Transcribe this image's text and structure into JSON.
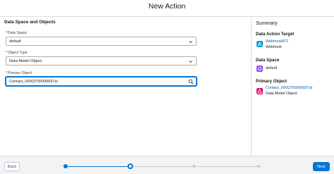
{
  "header": {
    "title": "New Action"
  },
  "form": {
    "section_title": "Data Space and Objects",
    "fields": [
      {
        "label": "Data Space",
        "value": "default",
        "required_mark": "*"
      },
      {
        "label": "Object Type",
        "value": "Data Model Object",
        "required_mark": "*"
      },
      {
        "label": "Primary Object",
        "value": "Contact_000QT00000097al",
        "required_mark": "*"
      }
    ]
  },
  "summary": {
    "title": "Summary",
    "target": {
      "heading": "Data Action Target",
      "name": "WebhookAT2",
      "type": "Webhook"
    },
    "data_space": {
      "heading": "Data Space",
      "value": "default"
    },
    "primary_object": {
      "heading": "Primary Object",
      "name": "Contact_000QT00000097al",
      "type": "Data Model Object"
    }
  },
  "footer": {
    "back_label": "Back",
    "next_label": "Next"
  },
  "progress": {
    "steps": 4,
    "current_step": 2
  },
  "colors": {
    "brand": "#0176d3",
    "link": "#0b5cab",
    "required": "#ba0517"
  }
}
